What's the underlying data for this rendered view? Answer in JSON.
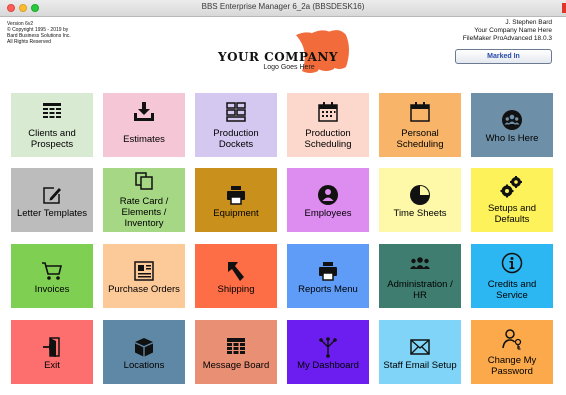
{
  "window": {
    "title": "BBS Enterprise Manager 6_2a (BBSDESK16)"
  },
  "info": {
    "version": "Version 6v2",
    "copyright": "© Copyright 1995 - 2019 by",
    "company": "Bard Business Solutions Inc.",
    "rights": "All Rights Reserved"
  },
  "user": {
    "name": "J. Stephen Bard",
    "company": "Your Company Name Here",
    "filemaker": "FileMaker ProAdvanced 18.0.3",
    "marked_in": "Marked In"
  },
  "logo": {
    "title": "YOUR COMPANY",
    "subtitle": "Logo Goes Here",
    "color": "#f26b3a"
  },
  "tiles": [
    {
      "label": "Clients and Prospects",
      "color": "#d9ead3",
      "icon": "table-list-icon"
    },
    {
      "label": "Estimates",
      "color": "#f5c6d6",
      "icon": "download-tray-icon"
    },
    {
      "label": "Production Dockets",
      "color": "#d4c8f0",
      "icon": "grid-panels-icon"
    },
    {
      "label": "Production Scheduling",
      "color": "#fcd7cb",
      "icon": "calendar-grid-icon"
    },
    {
      "label": "Personal Scheduling",
      "color": "#f8b56a",
      "icon": "calendar-blank-icon"
    },
    {
      "label": "Who Is Here",
      "color": "#6e8fa8",
      "icon": "people-circle-icon"
    },
    {
      "label": "Letter Templates",
      "color": "#bcbcbc",
      "icon": "edit-note-icon"
    },
    {
      "label": "Rate Card / Elements / Inventory",
      "color": "#a6d785",
      "icon": "copy-pages-icon"
    },
    {
      "label": "Equipment",
      "color": "#c9901c",
      "icon": "printer-icon"
    },
    {
      "label": "Employees",
      "color": "#dd8cf0",
      "icon": "person-circle-icon"
    },
    {
      "label": "Time Sheets",
      "color": "#fef9a9",
      "icon": "pie-chart-icon"
    },
    {
      "label": "Setups and Defaults",
      "color": "#fdf25a",
      "icon": "gears-icon"
    },
    {
      "label": "Invoices",
      "color": "#7fd052",
      "icon": "cart-icon"
    },
    {
      "label": "Purchase Orders",
      "color": "#fcc999",
      "icon": "newspaper-icon"
    },
    {
      "label": "Shipping",
      "color": "#fd6e47",
      "icon": "return-arrow-icon"
    },
    {
      "label": "Reports Menu",
      "color": "#5f9cf8",
      "icon": "printer-icon"
    },
    {
      "label": "Administration / HR",
      "color": "#3f7d70",
      "icon": "group-icon"
    },
    {
      "label": "Credits and Service",
      "color": "#2cb6f2",
      "icon": "info-circle-icon"
    },
    {
      "label": "Exit",
      "color": "#fd6e6e",
      "icon": "exit-door-icon"
    },
    {
      "label": "Locations",
      "color": "#5f88a6",
      "icon": "box-icon"
    },
    {
      "label": "Message Board",
      "color": "#e88f74",
      "icon": "message-grid-icon"
    },
    {
      "label": "My Dashboard",
      "color": "#6c1ef0",
      "icon": "network-icon"
    },
    {
      "label": "Staff Email Setup",
      "color": "#7fd4f7",
      "icon": "envelope-icon"
    },
    {
      "label": "Change My Password",
      "color": "#fba94a",
      "icon": "user-key-icon"
    }
  ]
}
